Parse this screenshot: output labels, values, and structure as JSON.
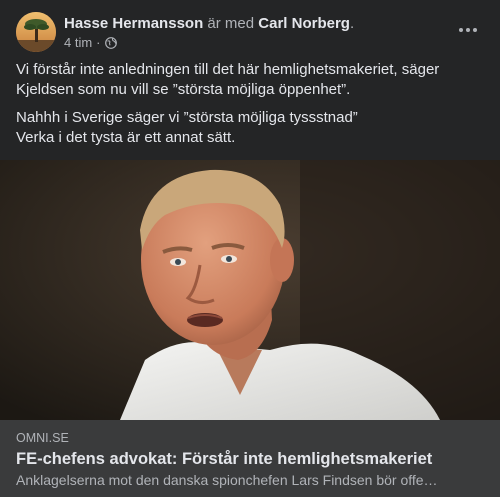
{
  "post": {
    "author": "Hasse Hermansson",
    "with_text": " är med ",
    "tagged": "Carl Norberg",
    "tagged_suffix": ".",
    "time": "4 tim",
    "dot": "·",
    "privacy_icon": "globe-icon",
    "more_icon": "more-options-icon",
    "paragraphs": [
      "Vi förstår inte anledningen till det här hemlighetsmakeriet, säger Kjeldsen som nu vill se ”största möjliga öppenhet”.",
      "Nahhh i Sverige säger vi ”största möjliga tyssstnad”",
      "Verka i det tysta är ett annat sätt."
    ]
  },
  "link": {
    "domain": "OMNI.SE",
    "headline": "FE-chefens advokat: Förstår inte hemlighetsmakeriet",
    "description": "Anklagelserna mot den danska spionchefen Lars Findsen bör offe…"
  },
  "colors": {
    "background": "#242526",
    "link_background": "#3a3b3c",
    "primary_text": "#e4e6eb",
    "secondary_text": "#b0b3b8"
  }
}
